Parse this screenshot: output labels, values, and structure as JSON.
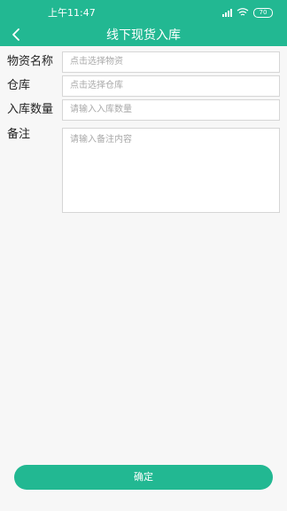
{
  "status_bar": {
    "time": "上午11:47",
    "battery": "70"
  },
  "nav": {
    "title": "线下现货入库"
  },
  "form": {
    "material_label": "物资名称",
    "material_placeholder": "点击选择物资",
    "warehouse_label": "仓库",
    "warehouse_placeholder": "点击选择仓库",
    "quantity_label": "入库数量",
    "quantity_placeholder": "请输入入库数量",
    "remark_label": "备注",
    "remark_placeholder": "请输入备注内容"
  },
  "footer": {
    "confirm_label": "确定"
  },
  "colors": {
    "brand": "#22b892",
    "background": "#f7f7f7"
  }
}
